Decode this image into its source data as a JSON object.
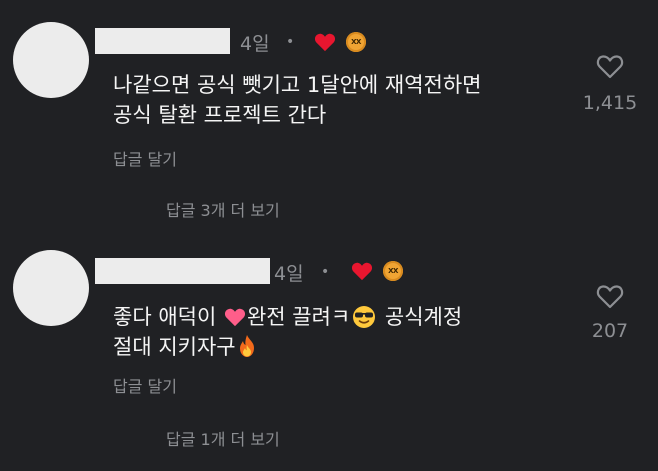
{
  "comments": [
    {
      "time": "4일",
      "dot": "•",
      "text_line1": "나같으면 공식 뺏기고 1달안에 재역전하면",
      "text_line2": "공식 탈환 프로젝트 간다",
      "reply_label": "답글 달기",
      "more_replies": "답글 3개 더 보기",
      "like_count": "1,415",
      "badge_text": "XX"
    },
    {
      "time": "4일",
      "dot": "•",
      "text_a": "좋다 애덕이 ",
      "text_b": "완전 끌려ㅋ",
      "text_c": " 공식계정",
      "text_d": "절대 지키자구",
      "reply_label": "답글 달기",
      "more_replies": "답글 1개 더 보기",
      "like_count": "207",
      "badge_text": "XX"
    }
  ],
  "colors": {
    "background": "#202124",
    "secondary_text": "#8d8f93",
    "heart": "#e8162f"
  }
}
